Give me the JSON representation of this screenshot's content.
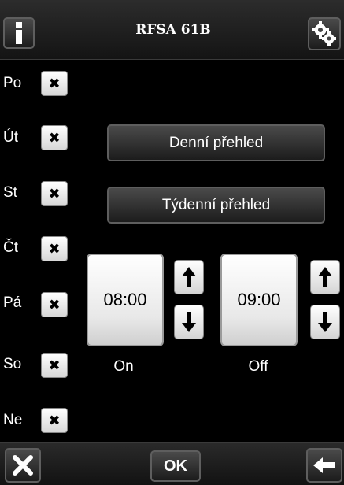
{
  "header": {
    "title": "RFSA 61B",
    "info_icon": "info-icon",
    "settings_icon": "gears-icon"
  },
  "days": [
    {
      "label": "Po",
      "checked": false
    },
    {
      "label": "Út",
      "checked": false
    },
    {
      "label": "St",
      "checked": false
    },
    {
      "label": "Čt",
      "checked": false
    },
    {
      "label": "Pá",
      "checked": false
    },
    {
      "label": "So",
      "checked": false
    },
    {
      "label": "Ne",
      "checked": false
    }
  ],
  "check_glyph": "✖",
  "buttons": {
    "daily": "Denní přehled",
    "weekly": "Týdenní přehled"
  },
  "times": {
    "on_value": "08:00",
    "on_label": "On",
    "off_value": "09:00",
    "off_label": "Off"
  },
  "footer": {
    "ok_label": "OK",
    "cancel_icon": "close-icon",
    "back_icon": "back-arrow-icon"
  }
}
